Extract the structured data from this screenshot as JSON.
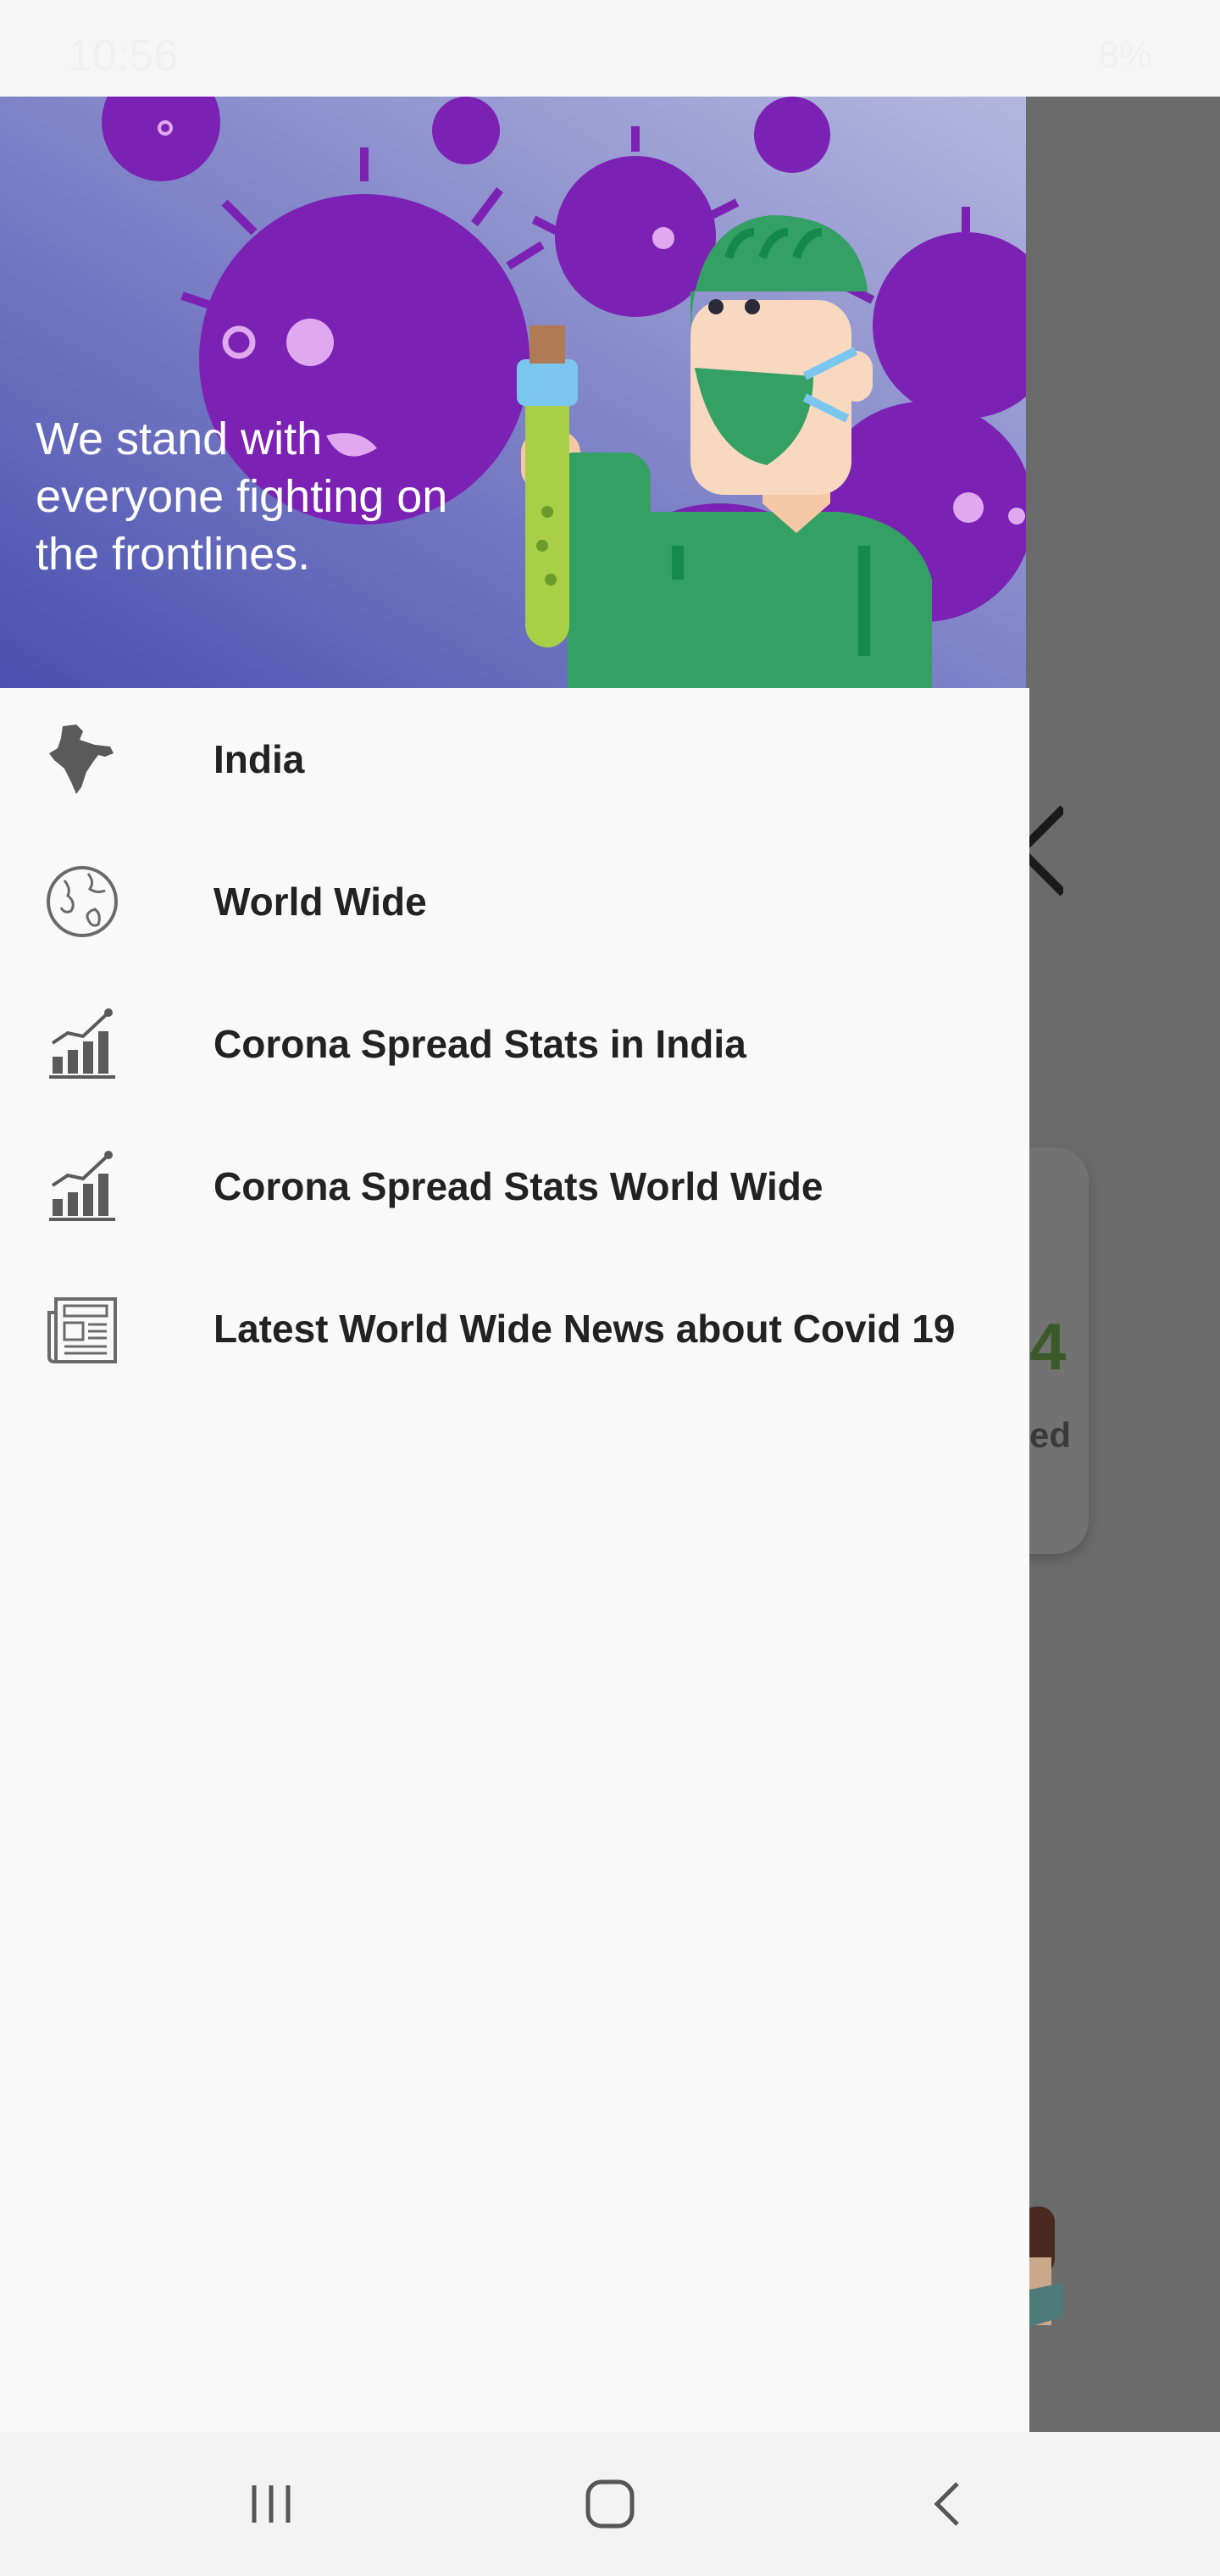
{
  "status_bar": {
    "time": "10:56",
    "right": "8%"
  },
  "drawer": {
    "header_text": "We stand with everyone fighting on the frontlines.",
    "items": [
      {
        "label": "India",
        "icon": "india-map-icon"
      },
      {
        "label": "World Wide",
        "icon": "globe-icon"
      },
      {
        "label": "Corona Spread Stats in India",
        "icon": "bar-chart-icon"
      },
      {
        "label": "Corona Spread Stats World Wide",
        "icon": "bar-chart-icon"
      },
      {
        "label": "Latest World Wide News about Covid 19",
        "icon": "newspaper-icon"
      }
    ]
  },
  "background_app": {
    "count_fragment": "4",
    "label_fragment": "ed"
  },
  "colors": {
    "header_gradient_top": "#a9acd9",
    "header_gradient_bottom": "#4e55b2",
    "virus": "#7b22b5",
    "scrim": "#6b6b6b",
    "drawer_bg": "#f9f9f9"
  }
}
